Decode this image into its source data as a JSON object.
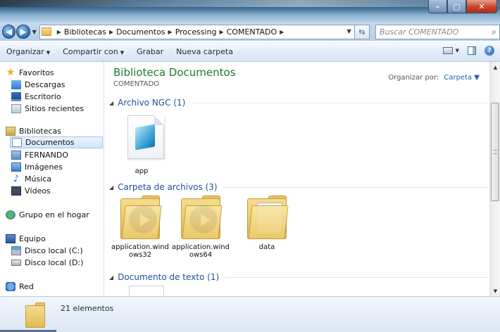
{
  "address": {
    "crumbs": [
      "Bibliotecas",
      "Documentos",
      "Processing",
      "COMENTADO"
    ],
    "search_placeholder": "Buscar COMENTADO"
  },
  "toolbar": {
    "organize": "Organizar",
    "share": "Compartir con",
    "burn": "Grabar",
    "new_folder": "Nueva carpeta"
  },
  "sidebar": {
    "favorites": {
      "label": "Favoritos",
      "items": [
        "Descargas",
        "Escritorio",
        "Sitios recientes"
      ]
    },
    "libraries": {
      "label": "Bibliotecas",
      "items": [
        "Documentos",
        "FERNANDO",
        "Imágenes",
        "Música",
        "Vídeos"
      ]
    },
    "homegroup": "Grupo en el hogar",
    "computer": {
      "label": "Equipo",
      "items": [
        "Disco local (C:)",
        "Disco local (D:)"
      ]
    },
    "network": "Red",
    "selected": "Documentos"
  },
  "main": {
    "title": "Biblioteca Documentos",
    "subtitle": "COMENTADO",
    "arrange_label": "Organizar por:",
    "arrange_value": "Carpeta",
    "groups": [
      {
        "label": "Archivo NGC (1)",
        "files": [
          "app"
        ]
      },
      {
        "label": "Carpeta de archivos (3)",
        "files": [
          "application.windows32",
          "application.windows64",
          "data"
        ]
      },
      {
        "label": "Documento de texto (1)",
        "files": []
      }
    ]
  },
  "status": {
    "count": "21 elementos"
  }
}
